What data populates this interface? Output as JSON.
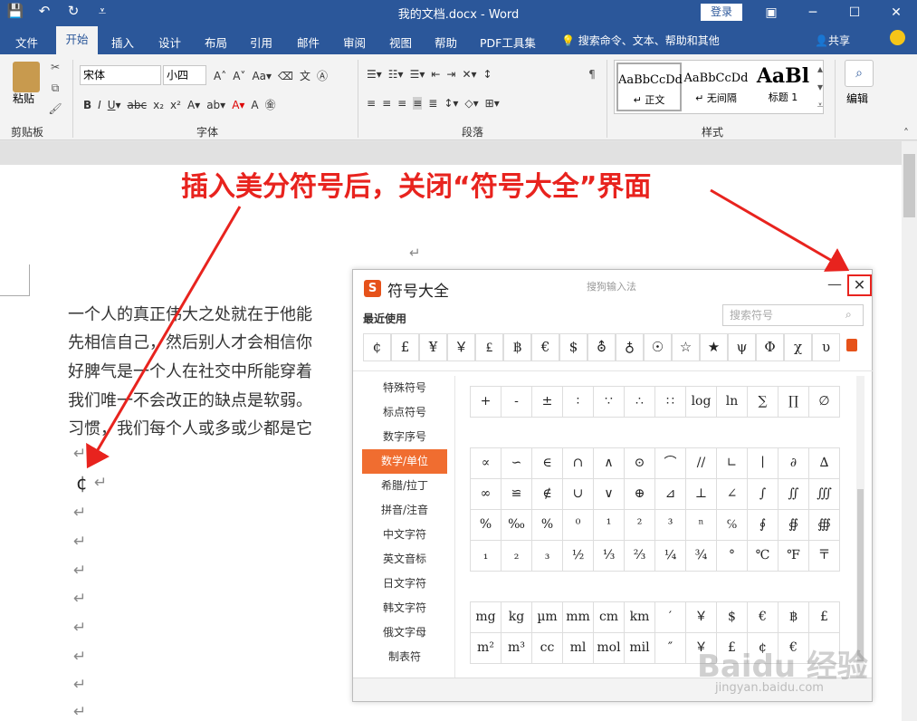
{
  "window": {
    "title": "我的文档.docx  -  Word",
    "login": "登录"
  },
  "qat": {
    "save": "💾",
    "undo": "↶",
    "redo": "↻",
    "more": "⩡"
  },
  "tabs": [
    "文件",
    "开始",
    "插入",
    "设计",
    "布局",
    "引用",
    "邮件",
    "审阅",
    "视图",
    "帮助",
    "PDF工具集"
  ],
  "active_tab": "开始",
  "tellme": "搜索命令、文本、帮助和其他",
  "share": "共享",
  "ribbon": {
    "clipboard": {
      "paste": "粘贴",
      "label": "剪贴板"
    },
    "font": {
      "name": "宋体",
      "size": "小四",
      "label": "字体"
    },
    "paragraph": {
      "label": "段落"
    },
    "styles": {
      "label": "样式",
      "items": [
        {
          "preview": "AaBbCcDd",
          "name": "↵ 正文"
        },
        {
          "preview": "AaBbCcDd",
          "name": "↵ 无间隔"
        },
        {
          "preview": "AaBl",
          "name": "标题 1"
        }
      ]
    },
    "editing": {
      "label": "编辑"
    }
  },
  "annotation": "插入美分符号后，关闭“符号大全”界面",
  "document": {
    "lines": [
      "一个人的真正伟大之处就在于他能",
      "先相信自己，然后别人才会相信你",
      "好脾气是一个人在社交中所能穿着",
      "我们唯一不会改正的缺点是软弱。",
      "习惯，我们每个人或多或少都是它"
    ],
    "inserted_symbol": "¢",
    "paragraph_mark": "↵"
  },
  "dialog": {
    "logo": "S",
    "title": "符号大全",
    "subtitle": "搜狗输入法",
    "minimize": "—",
    "close": "✕",
    "recent_label": "最近使用",
    "search_placeholder": "搜索符号",
    "recent": [
      "¢",
      "£",
      "¥",
      "￥",
      "₤",
      "฿",
      "€",
      "$",
      "⛢",
      "♁",
      "☉",
      "☆",
      "★",
      "ψ",
      "Φ",
      "χ",
      "υ"
    ],
    "categories": [
      "特殊符号",
      "标点符号",
      "数字序号",
      "数学/单位",
      "希腊/拉丁",
      "拼音/注音",
      "中文字符",
      "英文音标",
      "日文字符",
      "韩文字符",
      "俄文字母",
      "制表符"
    ],
    "active_category": "数学/单位",
    "block1": [
      "+",
      "-",
      "±",
      "∶",
      "∵",
      "∴",
      "∷",
      "log",
      "ln",
      "∑",
      "∏",
      "∅"
    ],
    "block2": [
      "∝",
      "∽",
      "∈",
      "∩",
      "∧",
      "⊙",
      "⌒",
      "//",
      "∟",
      "∣",
      "∂",
      "∆",
      "∞",
      "≌",
      "∉",
      "∪",
      "∨",
      "⊕",
      "⊿",
      "⊥",
      "∠",
      "∫",
      "∬",
      "∭",
      "%",
      "‰",
      "%",
      "⁰",
      "¹",
      "²",
      "³",
      "ⁿ",
      "℅",
      "∮",
      "∯",
      "∰",
      "₁",
      "₂",
      "₃",
      "½",
      "⅓",
      "⅔",
      "¼",
      "¾",
      "°",
      "℃",
      "℉",
      "〒"
    ],
    "block3": [
      "mg",
      "kg",
      "µm",
      "mm",
      "cm",
      "km",
      "′",
      "￥",
      "$",
      "€",
      "฿",
      "£",
      "m²",
      "m³",
      "cc",
      "ml",
      "mol",
      "mil",
      "″",
      "￥",
      "£",
      "¢",
      "€",
      ""
    ]
  },
  "watermark": {
    "main": "Baidu 经验",
    "sub": "jingyan.baidu.com"
  }
}
